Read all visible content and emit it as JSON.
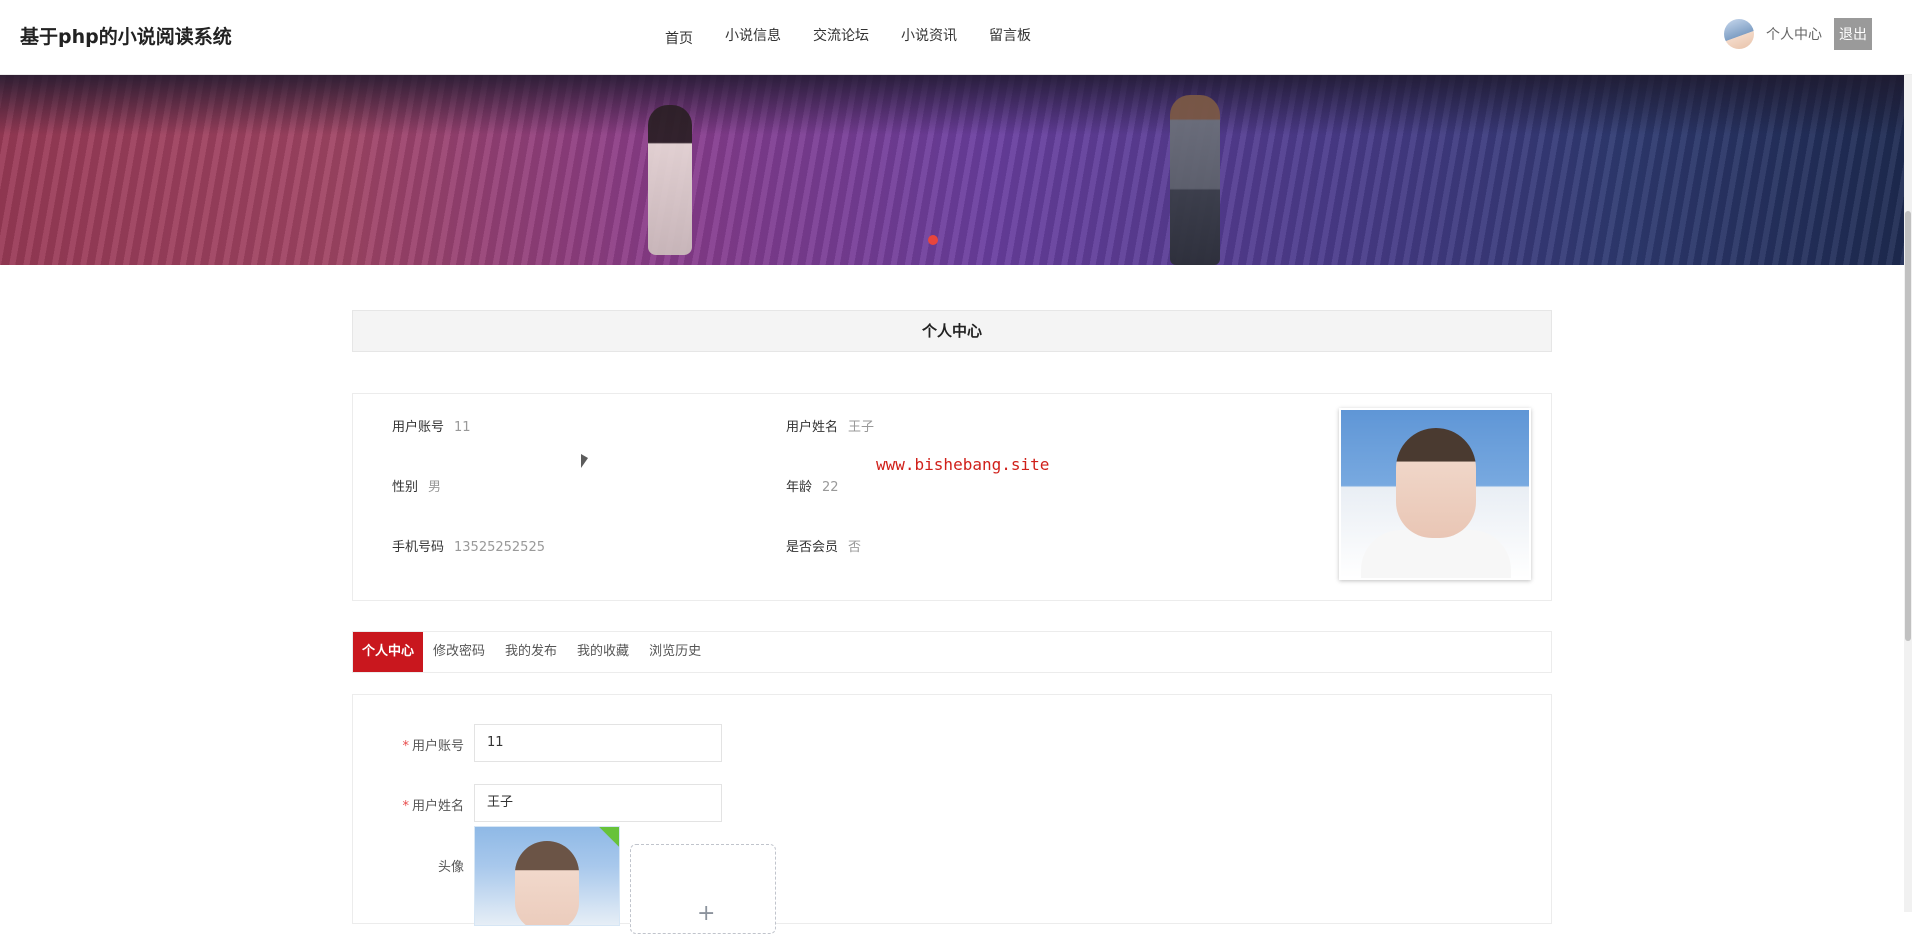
{
  "header": {
    "brand": "基于php的小说阅读系统",
    "nav": [
      "首页",
      "小说信息",
      "交流论坛",
      "小说资讯",
      "留言板"
    ],
    "user_center": "个人中心",
    "logout": "退出"
  },
  "banner": {
    "active_dot": 1
  },
  "profile": {
    "section_title": "个人中心",
    "fields": {
      "account_label": "用户账号",
      "account_value": "11",
      "name_label": "用户姓名",
      "name_value": "王子",
      "gender_label": "性别",
      "gender_value": "男",
      "age_label": "年龄",
      "age_value": "22",
      "phone_label": "手机号码",
      "phone_value": "13525252525",
      "vip_label": "是否会员",
      "vip_value": "否"
    },
    "watermark": "www.bishebang.site"
  },
  "tabs": [
    "个人中心",
    "修改密码",
    "我的发布",
    "我的收藏",
    "浏览历史"
  ],
  "form": {
    "account_label": "用户账号",
    "account_value": "11",
    "name_label": "用户姓名",
    "name_value": "王子",
    "avatar_label": "头像",
    "required_mark": "*",
    "add_icon": "+"
  }
}
